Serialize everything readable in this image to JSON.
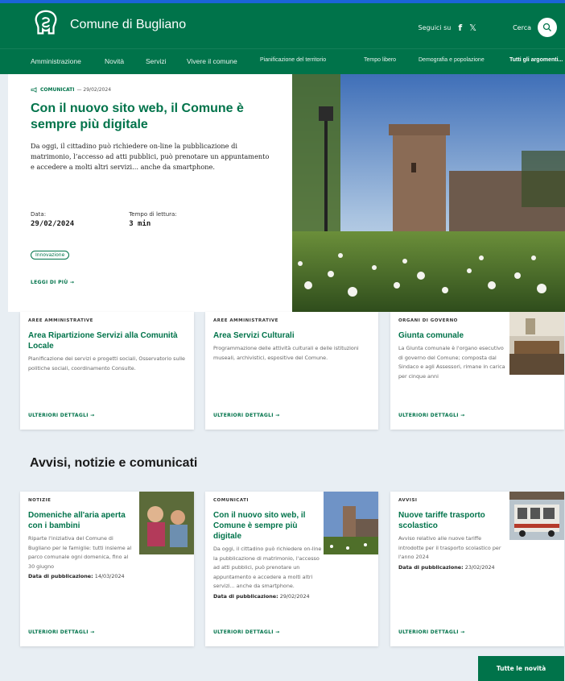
{
  "header": {
    "site_name": "Comune di Bugliano",
    "follow_label": "Seguici su",
    "search_label": "Cerca",
    "icons": [
      "logo-icon",
      "facebook-icon",
      "x-icon",
      "search-icon"
    ]
  },
  "nav": {
    "items": [
      "Amministrazione",
      "Novità",
      "Servizi",
      "Vivere il comune",
      "Pianificazione del territorio",
      "Tempo libero",
      "Demografia e popolazione",
      "Tutti gli argomenti..."
    ]
  },
  "hero": {
    "category": "COMUNICATI",
    "date_inline": "— 29/02/2024",
    "title": "Con il nuovo sito web, il Comune è sempre più digitale",
    "text": "Da oggi, il cittadino può richiedere on-line la pubblicazione di matrimonio, l’accesso ad atti pubblici, può prenotare un appuntamento e accedere a molti altri servizi... anche da smartphone.",
    "date_label": "Data:",
    "date_value": "29/02/2024",
    "reading_label": "Tempo di lettura:",
    "reading_value": "3 min",
    "tag": "Innovazione",
    "more": "LEGGI DI PIÙ →"
  },
  "areas": [
    {
      "type": "AREE AMMINISTRATIVE",
      "title": "Area Ripartizione Servizi alla Comunità Locale",
      "desc": "Pianificazione dei servizi e progetti sociali, Osservatorio sulle politiche sociali, coordinamento Consulte.",
      "cta": "ULTERIORI DETTAGLI →"
    },
    {
      "type": "AREE AMMINISTRATIVE",
      "title": "Area Servizi Culturali",
      "desc": "Programmazione delle attività culturali e delle istituzioni museali, archivistici, espositive del Comune.",
      "cta": "ULTERIORI DETTAGLI →"
    },
    {
      "type": "ORGANI DI GOVERNO",
      "title": "Giunta comunale",
      "desc": "La Giunta comunale è l'organo esecutivo di governo del Comune; composta dal Sindaco e agli Assessori, rimane in carica per cinque anni",
      "cta": "ULTERIORI DETTAGLI →"
    }
  ],
  "news_section": {
    "title": "Avvisi, notizie e comunicati",
    "cards": [
      {
        "type": "NOTIZIE",
        "title": "Domeniche all'aria aperta con i bambini",
        "desc": "Riparte l'iniziativa del Comune di Bugliano per le famiglie: tutti insieme al parco comunale ogni domenica, fino al 30 giugno",
        "date_label": "Data di pubblicazione:",
        "date": "14/03/2024",
        "cta": "ULTERIORI DETTAGLI →"
      },
      {
        "type": "COMUNICATI",
        "title": "Con il nuovo sito web, il Comune è sempre più digitale",
        "desc": "Da oggi, il cittadino può richiedere on-line la pubblicazione di matrimonio, l'accesso ad atti pubblici, può prenotare un appuntamento e accedere a molti altri servizi... anche da smartphone.",
        "date_label": "Data di pubblicazione:",
        "date": "29/02/2024",
        "cta": "ULTERIORI DETTAGLI →"
      },
      {
        "type": "AVVISI",
        "title": "Nuove tariffe trasporto scolastico",
        "desc": "Avviso relativo alle nuove tariffe introdotte per il trasporto scolastico per l'anno 2024",
        "date_label": "Data di pubblicazione:",
        "date": "23/02/2024",
        "cta": "ULTERIORI DETTAGLI →"
      }
    ],
    "all_button": "Tutte le novità"
  },
  "colors": {
    "brand": "#00734a",
    "top_strip": "#1b64d8",
    "page_bg": "#e8eef3"
  }
}
